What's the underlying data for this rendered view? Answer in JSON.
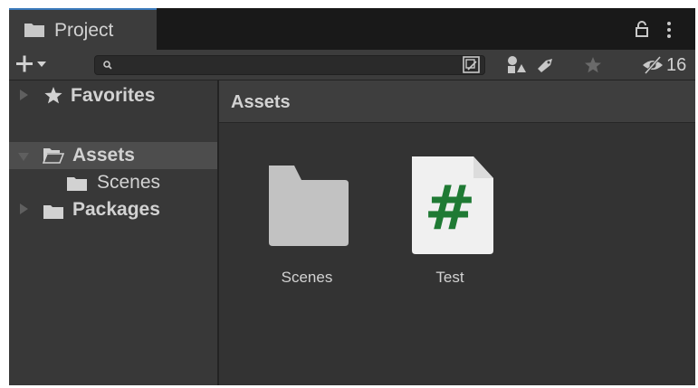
{
  "tab": {
    "label": "Project",
    "icon": "folder-icon"
  },
  "toolbar": {
    "create_icon": "plus-icon",
    "search": {
      "placeholder": "",
      "value": ""
    },
    "hidden_packages_count": "16"
  },
  "sidebar": {
    "items": [
      {
        "label": "Favorites",
        "icon": "star-icon",
        "expanded": false
      },
      {
        "label": "Assets",
        "icon": "folder-open-icon",
        "expanded": true,
        "selected": true
      },
      {
        "label": "Scenes",
        "icon": "folder-icon"
      },
      {
        "label": "Packages",
        "icon": "folder-icon",
        "expanded": false
      }
    ]
  },
  "main": {
    "breadcrumb": "Assets",
    "assets": [
      {
        "label": "Scenes",
        "type": "folder"
      },
      {
        "label": "Test",
        "type": "csharp-script",
        "glyph": "#"
      }
    ]
  },
  "colors": {
    "script_glyph": "#1f7a34",
    "folder": "#c2c2c2",
    "tab_accent": "#3a79bb"
  }
}
